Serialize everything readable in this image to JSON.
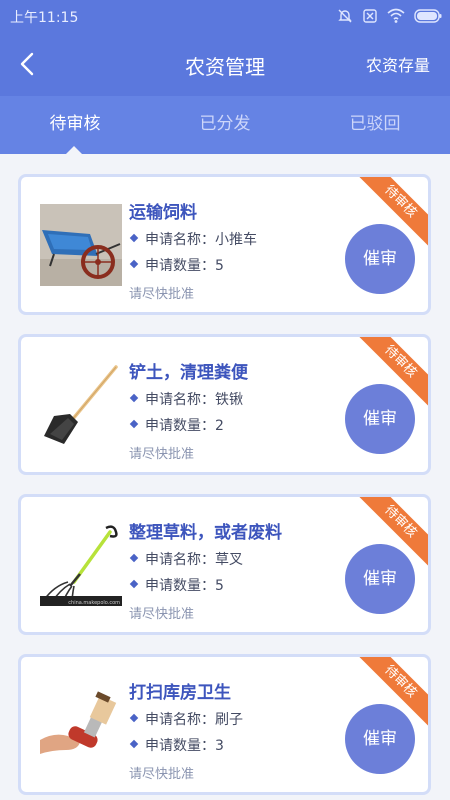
{
  "status_bar": {
    "time": "上午11:15",
    "icons": [
      "do-not-disturb-icon",
      "sim-off-icon",
      "wifi-icon",
      "battery-icon"
    ]
  },
  "nav": {
    "title": "农资管理",
    "action_label": "农资存量",
    "back_icon": "back-arrow-icon"
  },
  "tabs": [
    {
      "label": "待审核",
      "active": true
    },
    {
      "label": "已分发",
      "active": false
    },
    {
      "label": "已驳回",
      "active": false
    }
  ],
  "cards": [
    {
      "title": "运输饲料",
      "name_line": "申请名称：小推车",
      "qty_line": "申请数量：5",
      "hint": "请尽快批准",
      "button": "催审",
      "status": "待审核",
      "image": "wheelbarrow-image"
    },
    {
      "title": "铲土，清理粪便",
      "name_line": "申请名称：铁锹",
      "qty_line": "申请数量：2",
      "hint": "请尽快批准",
      "button": "催审",
      "status": "待审核",
      "image": "shovel-image"
    },
    {
      "title": "整理草料，或者废料",
      "name_line": "申请名称：草叉",
      "qty_line": "申请数量：5",
      "hint": "请尽快批准",
      "button": "催审",
      "status": "待审核",
      "image": "pitchfork-image",
      "image_caption": "china.makepolo.com"
    },
    {
      "title": "打扫库房卫生",
      "name_line": "申请名称：刷子",
      "qty_line": "申请数量：3",
      "hint": "请尽快批准",
      "button": "催审",
      "status": "待审核",
      "image": "brush-image"
    }
  ],
  "colors": {
    "header": "#5b78dd",
    "tabs": "#6583e4",
    "accent": "#3d55bd",
    "button": "#6c7fd9",
    "ribbon": "#ef7a3a",
    "card_border": "#d3ddf8"
  }
}
